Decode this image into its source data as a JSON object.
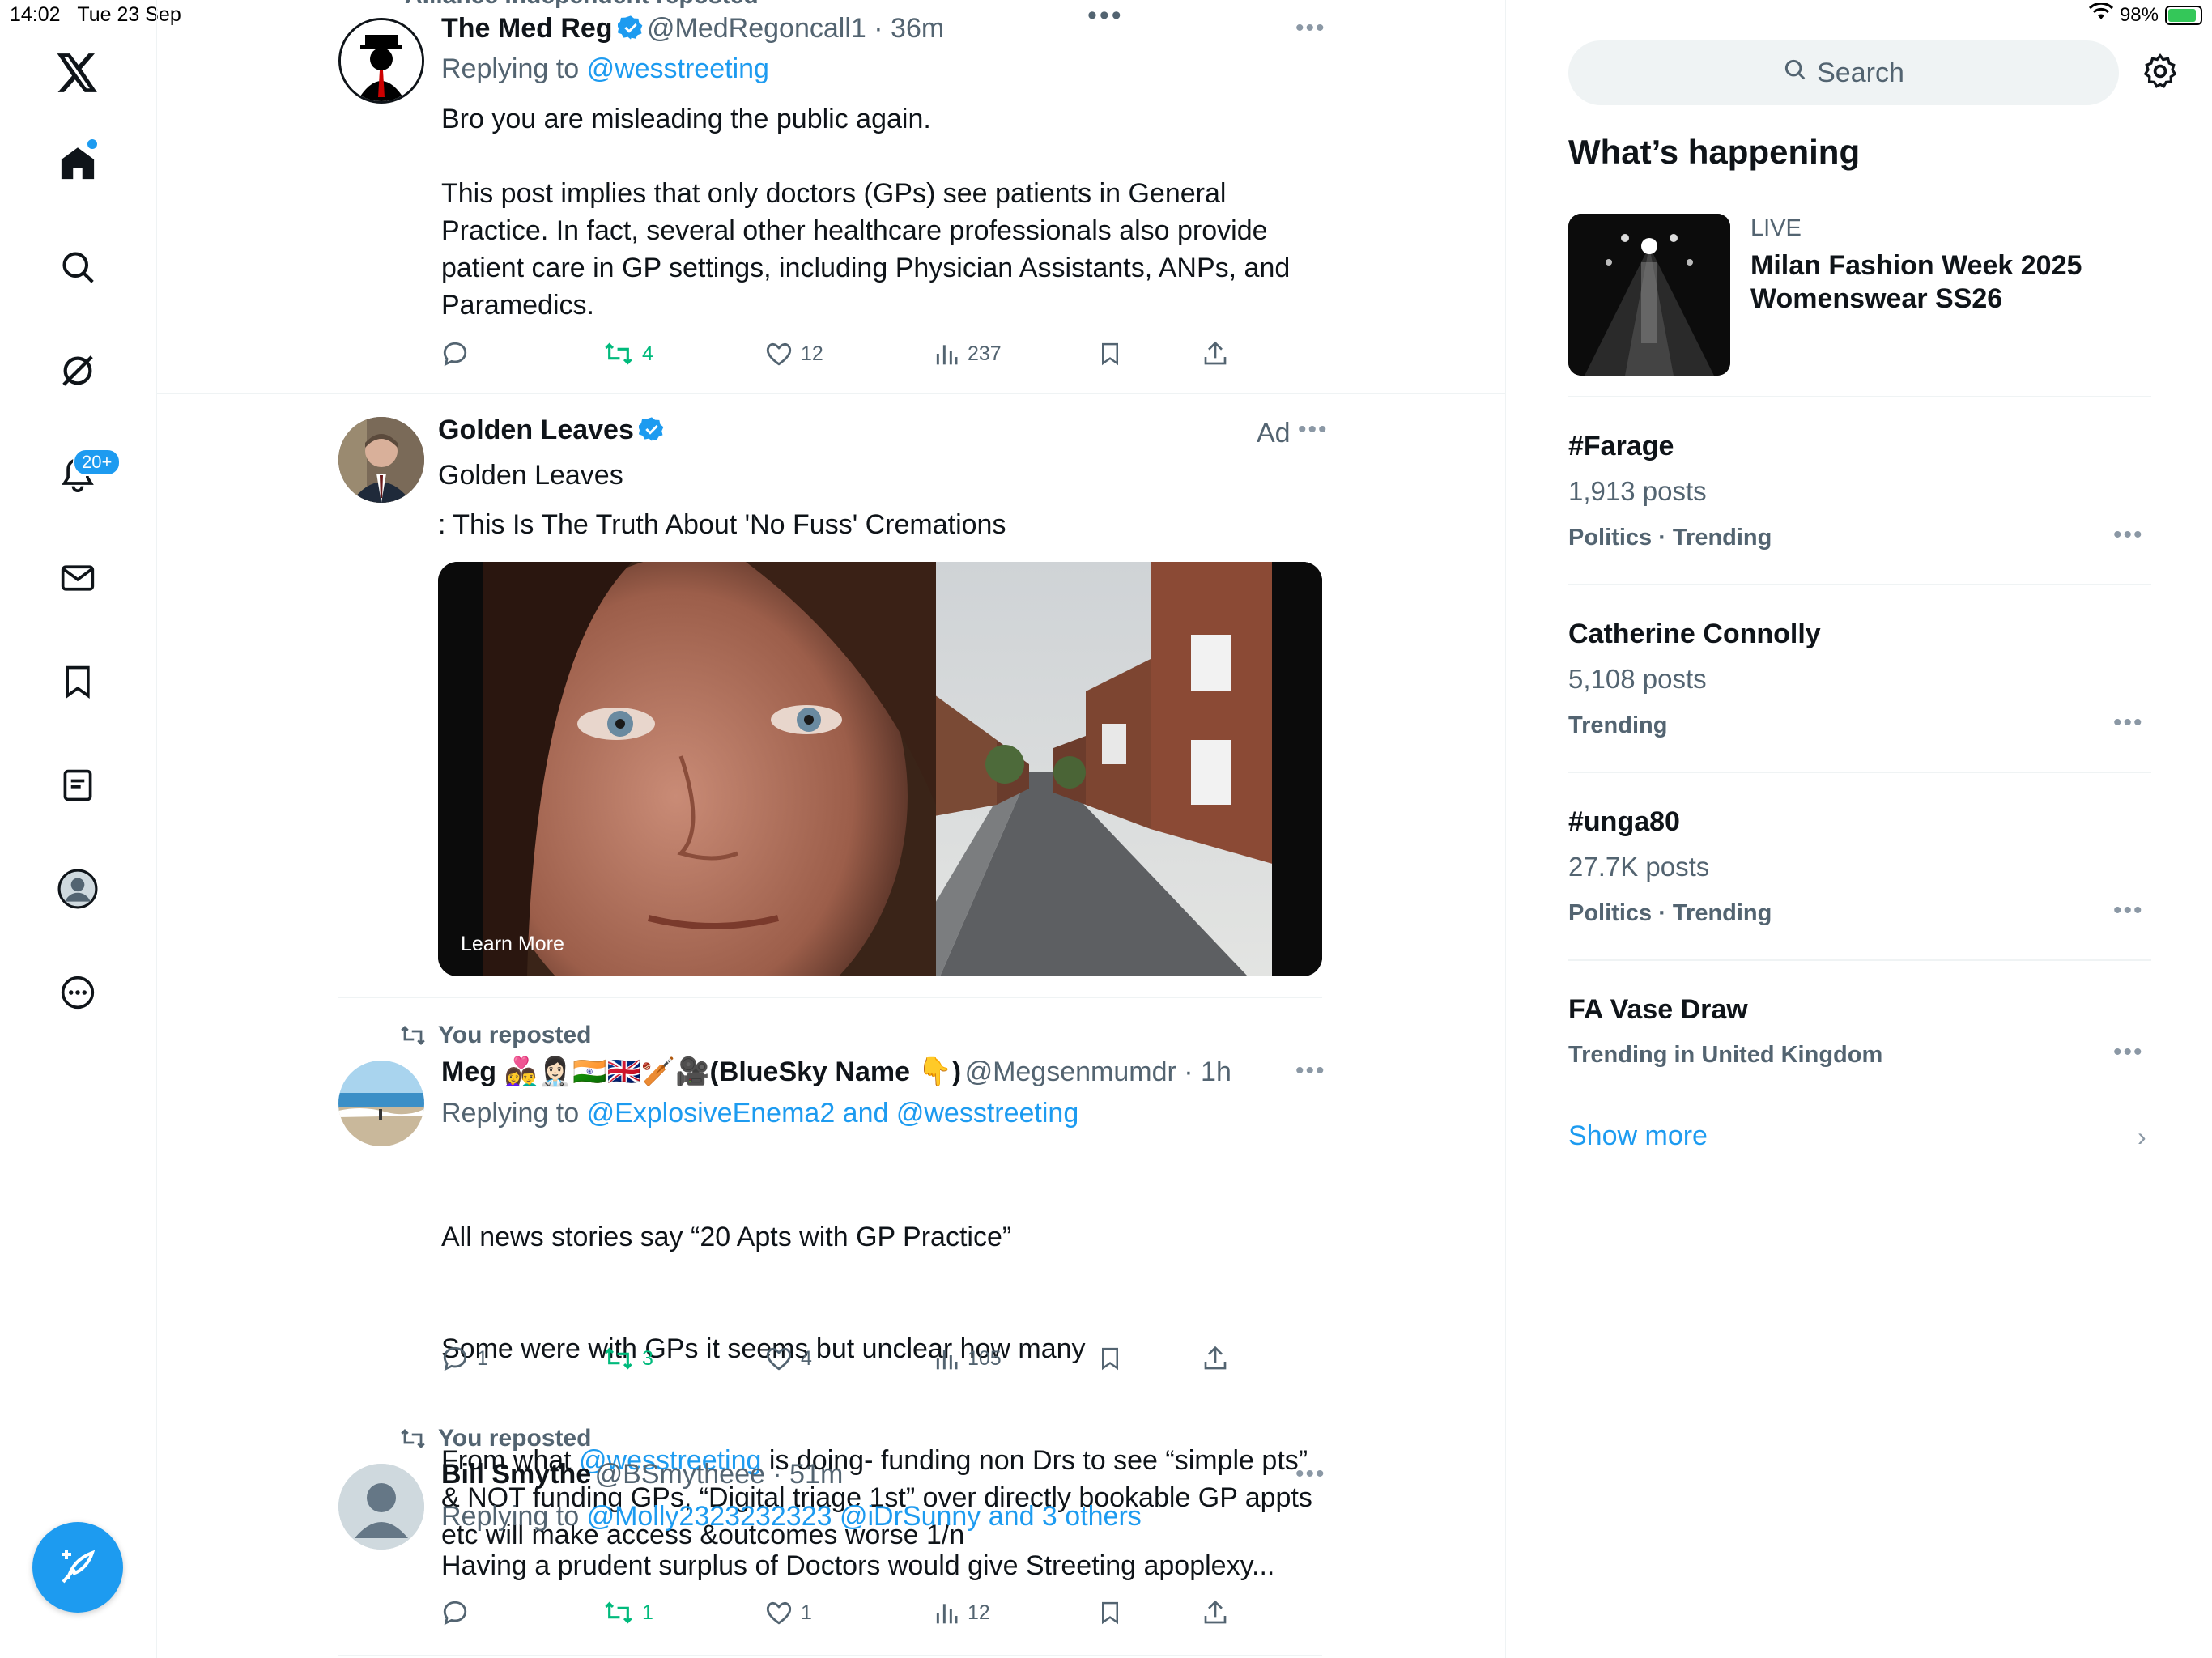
{
  "status_bar": {
    "time": "14:02",
    "date": "Tue 23 Sep",
    "battery": "98%"
  },
  "nav": {
    "notifications_badge": "20+"
  },
  "tweets": [
    {
      "header_partial": "Alliance Independent reposted",
      "name": "The Med Reg",
      "handle": "@MedRegoncall1",
      "time": "36m",
      "reply_prefix": "Replying to",
      "reply_to": "@wesstreeting",
      "text": "Bro you are misleading the public again.\n\nThis post implies that only doctors (GPs) see patients in General Practice. In fact, several other healthcare professionals also provide patient care in GP settings, including Physician Assistants, ANPs, and Paramedics.",
      "replies": "",
      "reposts": "4",
      "likes": "12",
      "views": "237"
    },
    {
      "name": "Golden Leaves",
      "subtitle": "Golden Leaves",
      "ad_label": "Ad",
      "text": ": This Is The Truth About 'No Fuss' Cremations",
      "cta": "Learn More"
    },
    {
      "repost_label": "You reposted",
      "name": "Meg 👩‍❤️‍👨👩🏻‍⚕️🇮🇳🇬🇧🏏🎥(BlueSky Name 👇)",
      "handle": "@Megsenmumdr",
      "time": "1h",
      "reply_prefix": "Replying to",
      "reply_to": "@ExplosiveEnema2 and @wesstreeting",
      "text_lines": [
        "All news stories say “20 Apts with GP Practice”",
        "Some were with GPs it seems but unclear how many"
      ],
      "text_before_link": "From what ",
      "text_link": "@wesstreeting",
      "text_after_link": " is doing- funding non Drs to see “simple pts”\n& NOT funding GPs, “Digital triage 1st” over directly bookable GP appts\netc will make access &outcomes worse 1/n",
      "replies": "1",
      "reposts": "3",
      "likes": "4",
      "views": "105"
    },
    {
      "repost_label": "You reposted",
      "name": "Bill Smythe",
      "handle": "@BSmytheee",
      "time": "51m",
      "reply_prefix": "Replying to",
      "reply_to": "@Molly2323232323 @iDrSunny and 3 others",
      "text": "Having a prudent surplus of Doctors would give Streeting apoplexy...",
      "replies": "",
      "reposts": "1",
      "likes": "1",
      "views": "12"
    }
  ],
  "sidebar": {
    "search_placeholder": "Search",
    "title": "What’s happening",
    "live": {
      "label": "LIVE",
      "title": "Milan Fashion Week 2025 Womenswear SS26"
    },
    "trends": [
      {
        "name": "#Farage",
        "count": "1,913 posts",
        "category": "Politics · Trending"
      },
      {
        "name": "Catherine Connolly",
        "count": "5,108 posts",
        "category": "Trending"
      },
      {
        "name": "#unga80",
        "count": "27.7K posts",
        "category": "Politics · Trending"
      },
      {
        "name": "FA Vase Draw",
        "count": "",
        "category": "Trending in United Kingdom"
      }
    ],
    "show_more": "Show more"
  },
  "colors": {
    "accent": "#1d9bf0",
    "repost_green": "#00ba7c",
    "muted": "#536471"
  }
}
